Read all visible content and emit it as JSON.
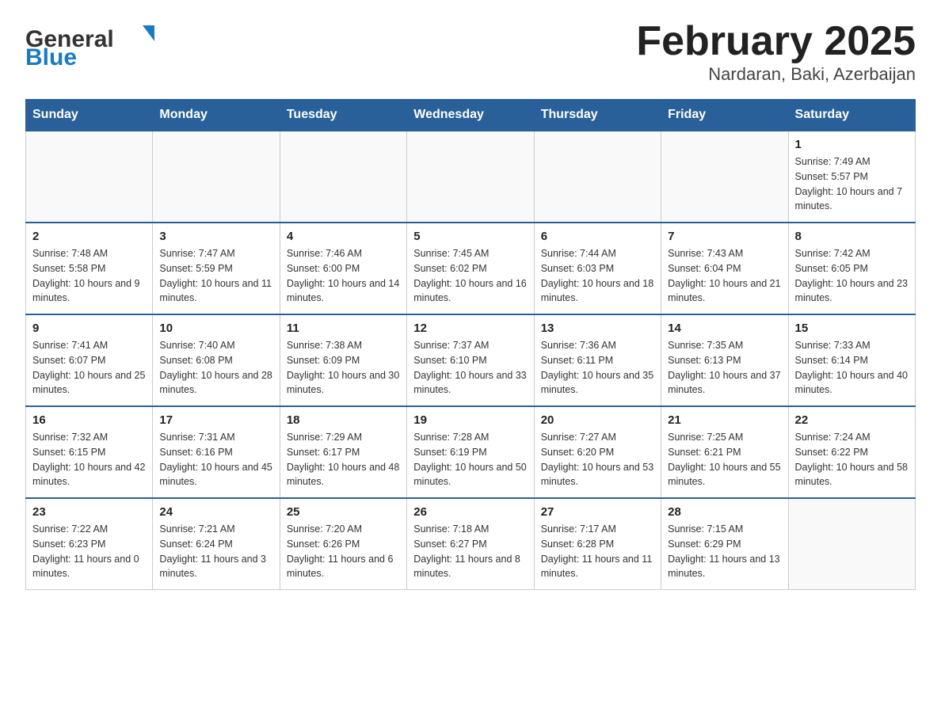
{
  "header": {
    "title": "February 2025",
    "subtitle": "Nardaran, Baki, Azerbaijan"
  },
  "days_of_week": [
    "Sunday",
    "Monday",
    "Tuesday",
    "Wednesday",
    "Thursday",
    "Friday",
    "Saturday"
  ],
  "weeks": [
    [
      {
        "day": "",
        "info": ""
      },
      {
        "day": "",
        "info": ""
      },
      {
        "day": "",
        "info": ""
      },
      {
        "day": "",
        "info": ""
      },
      {
        "day": "",
        "info": ""
      },
      {
        "day": "",
        "info": ""
      },
      {
        "day": "1",
        "info": "Sunrise: 7:49 AM\nSunset: 5:57 PM\nDaylight: 10 hours and 7 minutes."
      }
    ],
    [
      {
        "day": "2",
        "info": "Sunrise: 7:48 AM\nSunset: 5:58 PM\nDaylight: 10 hours and 9 minutes."
      },
      {
        "day": "3",
        "info": "Sunrise: 7:47 AM\nSunset: 5:59 PM\nDaylight: 10 hours and 11 minutes."
      },
      {
        "day": "4",
        "info": "Sunrise: 7:46 AM\nSunset: 6:00 PM\nDaylight: 10 hours and 14 minutes."
      },
      {
        "day": "5",
        "info": "Sunrise: 7:45 AM\nSunset: 6:02 PM\nDaylight: 10 hours and 16 minutes."
      },
      {
        "day": "6",
        "info": "Sunrise: 7:44 AM\nSunset: 6:03 PM\nDaylight: 10 hours and 18 minutes."
      },
      {
        "day": "7",
        "info": "Sunrise: 7:43 AM\nSunset: 6:04 PM\nDaylight: 10 hours and 21 minutes."
      },
      {
        "day": "8",
        "info": "Sunrise: 7:42 AM\nSunset: 6:05 PM\nDaylight: 10 hours and 23 minutes."
      }
    ],
    [
      {
        "day": "9",
        "info": "Sunrise: 7:41 AM\nSunset: 6:07 PM\nDaylight: 10 hours and 25 minutes."
      },
      {
        "day": "10",
        "info": "Sunrise: 7:40 AM\nSunset: 6:08 PM\nDaylight: 10 hours and 28 minutes."
      },
      {
        "day": "11",
        "info": "Sunrise: 7:38 AM\nSunset: 6:09 PM\nDaylight: 10 hours and 30 minutes."
      },
      {
        "day": "12",
        "info": "Sunrise: 7:37 AM\nSunset: 6:10 PM\nDaylight: 10 hours and 33 minutes."
      },
      {
        "day": "13",
        "info": "Sunrise: 7:36 AM\nSunset: 6:11 PM\nDaylight: 10 hours and 35 minutes."
      },
      {
        "day": "14",
        "info": "Sunrise: 7:35 AM\nSunset: 6:13 PM\nDaylight: 10 hours and 37 minutes."
      },
      {
        "day": "15",
        "info": "Sunrise: 7:33 AM\nSunset: 6:14 PM\nDaylight: 10 hours and 40 minutes."
      }
    ],
    [
      {
        "day": "16",
        "info": "Sunrise: 7:32 AM\nSunset: 6:15 PM\nDaylight: 10 hours and 42 minutes."
      },
      {
        "day": "17",
        "info": "Sunrise: 7:31 AM\nSunset: 6:16 PM\nDaylight: 10 hours and 45 minutes."
      },
      {
        "day": "18",
        "info": "Sunrise: 7:29 AM\nSunset: 6:17 PM\nDaylight: 10 hours and 48 minutes."
      },
      {
        "day": "19",
        "info": "Sunrise: 7:28 AM\nSunset: 6:19 PM\nDaylight: 10 hours and 50 minutes."
      },
      {
        "day": "20",
        "info": "Sunrise: 7:27 AM\nSunset: 6:20 PM\nDaylight: 10 hours and 53 minutes."
      },
      {
        "day": "21",
        "info": "Sunrise: 7:25 AM\nSunset: 6:21 PM\nDaylight: 10 hours and 55 minutes."
      },
      {
        "day": "22",
        "info": "Sunrise: 7:24 AM\nSunset: 6:22 PM\nDaylight: 10 hours and 58 minutes."
      }
    ],
    [
      {
        "day": "23",
        "info": "Sunrise: 7:22 AM\nSunset: 6:23 PM\nDaylight: 11 hours and 0 minutes."
      },
      {
        "day": "24",
        "info": "Sunrise: 7:21 AM\nSunset: 6:24 PM\nDaylight: 11 hours and 3 minutes."
      },
      {
        "day": "25",
        "info": "Sunrise: 7:20 AM\nSunset: 6:26 PM\nDaylight: 11 hours and 6 minutes."
      },
      {
        "day": "26",
        "info": "Sunrise: 7:18 AM\nSunset: 6:27 PM\nDaylight: 11 hours and 8 minutes."
      },
      {
        "day": "27",
        "info": "Sunrise: 7:17 AM\nSunset: 6:28 PM\nDaylight: 11 hours and 11 minutes."
      },
      {
        "day": "28",
        "info": "Sunrise: 7:15 AM\nSunset: 6:29 PM\nDaylight: 11 hours and 13 minutes."
      },
      {
        "day": "",
        "info": ""
      }
    ]
  ]
}
